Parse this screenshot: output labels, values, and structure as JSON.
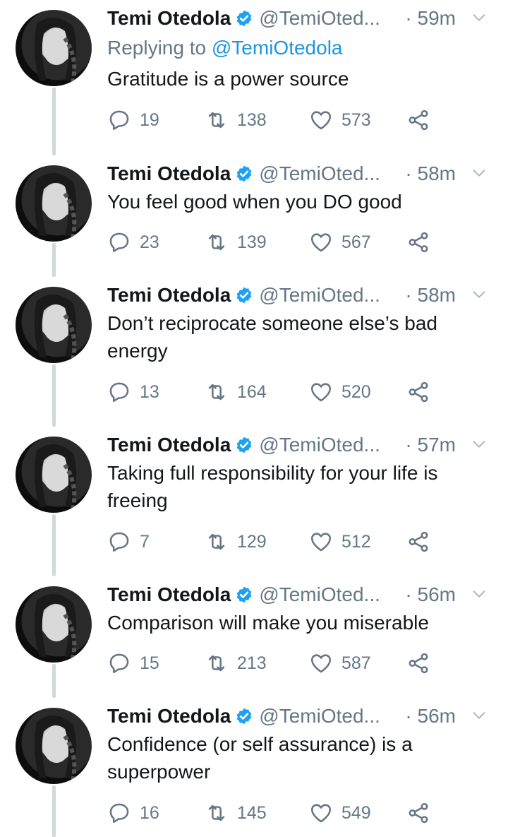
{
  "tweets": [
    {
      "name": "Temi Otedola",
      "handle": "@TemiOted...",
      "time": "· 59m",
      "replying_label": "Replying to",
      "replying_to": "@TemiOtedola",
      "text": "Gratitude is a power source",
      "replies": "19",
      "retweets": "138",
      "likes": "573"
    },
    {
      "name": "Temi Otedola",
      "handle": "@TemiOted...",
      "time": "· 58m",
      "text": "You feel good when you DO good",
      "replies": "23",
      "retweets": "139",
      "likes": "567"
    },
    {
      "name": "Temi Otedola",
      "handle": "@TemiOted...",
      "time": "· 58m",
      "text": "Don’t reciprocate someone else’s bad energy",
      "replies": "13",
      "retweets": "164",
      "likes": "520"
    },
    {
      "name": "Temi Otedola",
      "handle": "@TemiOted...",
      "time": "· 57m",
      "text": "Taking full responsibility for your life is freeing",
      "replies": "7",
      "retweets": "129",
      "likes": "512"
    },
    {
      "name": "Temi Otedola",
      "handle": "@TemiOted...",
      "time": "· 56m",
      "text": "Comparison will make you miserable",
      "replies": "15",
      "retweets": "213",
      "likes": "587"
    },
    {
      "name": "Temi Otedola",
      "handle": "@TemiOted...",
      "time": "· 56m",
      "text": "Confidence (or self assurance) is a superpower",
      "replies": "16",
      "retweets": "145",
      "likes": "549"
    }
  ],
  "colors": {
    "text": "#14171a",
    "muted": "#657786",
    "link": "#1b95e0",
    "verified": "#1da1f2",
    "rail": "#cfd9de"
  },
  "icons": [
    "verified-badge-icon",
    "chevron-down-icon",
    "reply-icon",
    "retweet-icon",
    "like-icon",
    "share-icon"
  ]
}
